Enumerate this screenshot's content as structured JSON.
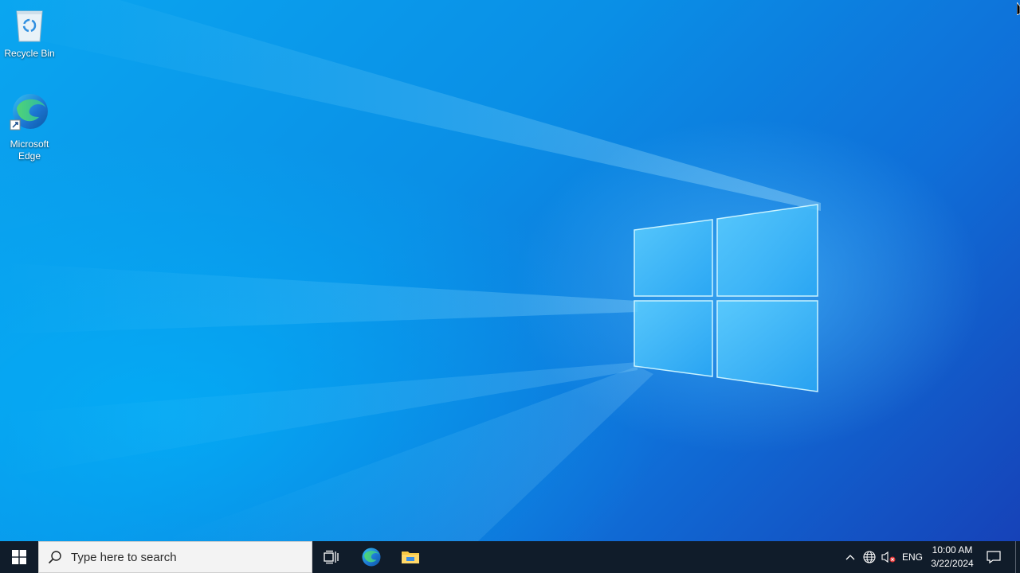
{
  "desktop": {
    "icons": [
      {
        "label": "Recycle Bin",
        "icon": "recycle-bin-icon"
      },
      {
        "label": "Microsoft Edge",
        "icon": "edge-icon"
      }
    ],
    "wallpaper": "windows-10-hero",
    "colors": {
      "accent": "#0a8fe6",
      "deep": "#1642b8",
      "taskbar": "#101c2a"
    }
  },
  "taskbar": {
    "start_icon": "windows-start-icon",
    "search": {
      "placeholder": "Type here to search",
      "icon": "search-icon"
    },
    "pinned": [
      {
        "name": "Task View",
        "icon": "task-view-icon"
      },
      {
        "name": "Microsoft Edge",
        "icon": "edge-icon"
      },
      {
        "name": "File Explorer",
        "icon": "file-explorer-icon"
      }
    ],
    "tray": {
      "overflow_icon": "chevron-up-icon",
      "network_icon": "globe-network-icon",
      "volume_icon": "volume-muted-icon",
      "language": "ENG"
    },
    "clock": {
      "time": "10:00 AM",
      "date": "3/22/2024"
    },
    "notification_icon": "action-center-icon"
  }
}
